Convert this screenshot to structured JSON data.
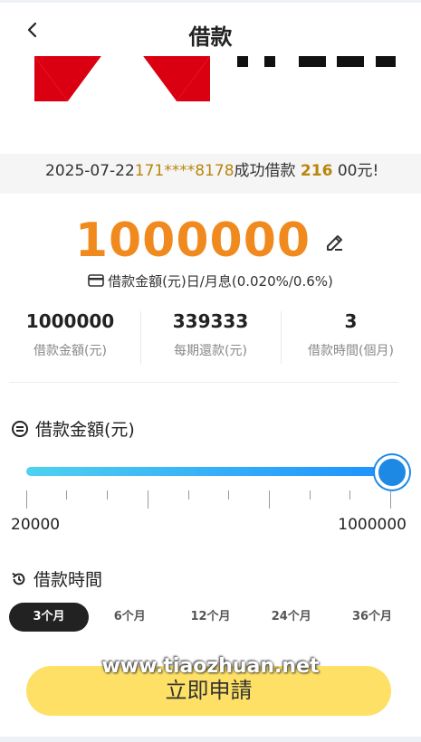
{
  "header": {
    "title": "借款"
  },
  "ticker": {
    "lines": [
      {
        "date": "2025-07-22",
        "phone": "171****8178",
        "mid": "成功借款 ",
        "amount": "216",
        "tail": "00元!"
      }
    ]
  },
  "loan": {
    "amount": "1000000",
    "rate_text": "借款金額(元)日/月息(0.020%/0.6%)"
  },
  "stats": [
    {
      "value": "1000000",
      "label": "借款金額(元)"
    },
    {
      "value": "339333",
      "label": "每期還款(元)"
    },
    {
      "value": "3",
      "label": "借款時間(個月)"
    }
  ],
  "amount_section": {
    "title": "借款金額(元)",
    "min": "20000",
    "max": "1000000",
    "slider_fraction": 1.0
  },
  "term_section": {
    "title": "借款時間",
    "options": [
      "3个月",
      "6个月",
      "12个月",
      "24个月",
      "36个月"
    ],
    "selected_index": 0
  },
  "apply_button": {
    "label": "立即申請"
  },
  "watermark": "www.tiaozhuan.net",
  "colors": {
    "amount": "#f08a1e",
    "slider_start": "#4fd1f0",
    "slider_end": "#1e90ff",
    "apply_bg": "#fde065",
    "logo_red": "#db0011"
  },
  "icons": {
    "back": "chevron-left-icon",
    "edit": "edit-icon",
    "card": "card-icon",
    "amount_section": "coin-icon",
    "term_section": "history-icon"
  }
}
